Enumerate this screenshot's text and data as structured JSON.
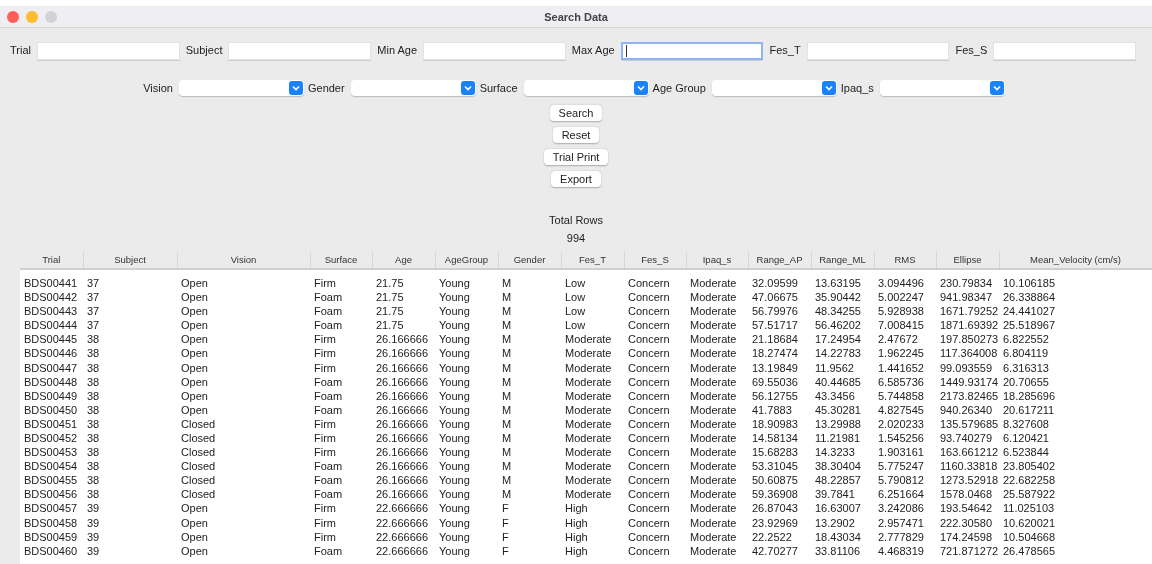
{
  "window": {
    "title": "Search Data"
  },
  "text_fields": [
    {
      "label": "Trial",
      "focused": false
    },
    {
      "label": "Subject",
      "focused": false
    },
    {
      "label": "Min Age",
      "focused": false
    },
    {
      "label": "Max Age",
      "focused": true
    },
    {
      "label": "Fes_T",
      "focused": false
    },
    {
      "label": "Fes_S",
      "focused": false
    }
  ],
  "dropdowns": [
    {
      "label": "Vision"
    },
    {
      "label": "Gender"
    },
    {
      "label": "Surface"
    },
    {
      "label": "Age Group"
    },
    {
      "label": "Ipaq_s"
    }
  ],
  "buttons": [
    "Search",
    "Reset",
    "Trial Print",
    "Export"
  ],
  "total": {
    "label": "Total Rows",
    "value": "994"
  },
  "table": {
    "columns": [
      "Trial",
      "Subject",
      "Vision",
      "Surface",
      "Age",
      "AgeGroup",
      "Gender",
      "Fes_T",
      "Fes_S",
      "Ipaq_s",
      "Range_AP",
      "Range_ML",
      "RMS",
      "Ellipse",
      "Mean_Velocity (cm/s)"
    ],
    "rows": [
      [
        "BDS00441",
        "37",
        "Open",
        "Firm",
        "21.75",
        "Young",
        "M",
        "Low",
        "Concern",
        "Moderate",
        "32.09599",
        "13.63195",
        "3.094496",
        "230.79834",
        "10.106185"
      ],
      [
        "BDS00442",
        "37",
        "Open",
        "Foam",
        "21.75",
        "Young",
        "M",
        "Low",
        "Concern",
        "Moderate",
        "47.06675",
        "35.90442",
        "5.002247",
        "941.98347",
        "26.338864"
      ],
      [
        "BDS00443",
        "37",
        "Open",
        "Foam",
        "21.75",
        "Young",
        "M",
        "Low",
        "Concern",
        "Moderate",
        "56.79976",
        "48.34255",
        "5.928938",
        "1671.79252",
        "24.441027"
      ],
      [
        "BDS00444",
        "37",
        "Open",
        "Foam",
        "21.75",
        "Young",
        "M",
        "Low",
        "Concern",
        "Moderate",
        "57.51717",
        "56.46202",
        "7.008415",
        "1871.69392",
        "25.518967"
      ],
      [
        "BDS00445",
        "38",
        "Open",
        "Firm",
        "26.166666",
        "Young",
        "M",
        "Moderate",
        "Concern",
        "Moderate",
        "21.18684",
        "17.24954",
        "2.47672",
        "197.850273",
        "6.822552"
      ],
      [
        "BDS00446",
        "38",
        "Open",
        "Firm",
        "26.166666",
        "Young",
        "M",
        "Moderate",
        "Concern",
        "Moderate",
        "18.27474",
        "14.22783",
        "1.962245",
        "117.364008",
        "6.804119"
      ],
      [
        "BDS00447",
        "38",
        "Open",
        "Firm",
        "26.166666",
        "Young",
        "M",
        "Moderate",
        "Concern",
        "Moderate",
        "13.19849",
        "11.9562",
        "1.441652",
        "99.093559",
        "6.316313"
      ],
      [
        "BDS00448",
        "38",
        "Open",
        "Foam",
        "26.166666",
        "Young",
        "M",
        "Moderate",
        "Concern",
        "Moderate",
        "69.55036",
        "40.44685",
        "6.585736",
        "1449.93174",
        "20.70655"
      ],
      [
        "BDS00449",
        "38",
        "Open",
        "Foam",
        "26.166666",
        "Young",
        "M",
        "Moderate",
        "Concern",
        "Moderate",
        "56.12755",
        "43.3456",
        "5.744858",
        "2173.82465",
        "18.285696"
      ],
      [
        "BDS00450",
        "38",
        "Open",
        "Foam",
        "26.166666",
        "Young",
        "M",
        "Moderate",
        "Concern",
        "Moderate",
        "41.7883",
        "45.30281",
        "4.827545",
        "940.26340",
        "20.617211"
      ],
      [
        "BDS00451",
        "38",
        "Closed",
        "Firm",
        "26.166666",
        "Young",
        "M",
        "Moderate",
        "Concern",
        "Moderate",
        "18.90983",
        "13.29988",
        "2.020233",
        "135.579685",
        "8.327608"
      ],
      [
        "BDS00452",
        "38",
        "Closed",
        "Firm",
        "26.166666",
        "Young",
        "M",
        "Moderate",
        "Concern",
        "Moderate",
        "14.58134",
        "11.21981",
        "1.545256",
        "93.740279",
        "6.120421"
      ],
      [
        "BDS00453",
        "38",
        "Closed",
        "Firm",
        "26.166666",
        "Young",
        "M",
        "Moderate",
        "Concern",
        "Moderate",
        "15.68283",
        "14.3233",
        "1.903161",
        "163.661212",
        "6.523844"
      ],
      [
        "BDS00454",
        "38",
        "Closed",
        "Foam",
        "26.166666",
        "Young",
        "M",
        "Moderate",
        "Concern",
        "Moderate",
        "53.31045",
        "38.30404",
        "5.775247",
        "1160.33818",
        "23.805402"
      ],
      [
        "BDS00455",
        "38",
        "Closed",
        "Foam",
        "26.166666",
        "Young",
        "M",
        "Moderate",
        "Concern",
        "Moderate",
        "50.60875",
        "48.22857",
        "5.790812",
        "1273.52918",
        "22.682258"
      ],
      [
        "BDS00456",
        "38",
        "Closed",
        "Foam",
        "26.166666",
        "Young",
        "M",
        "Moderate",
        "Concern",
        "Moderate",
        "59.36908",
        "39.7841",
        "6.251664",
        "1578.0468",
        "25.587922"
      ],
      [
        "BDS00457",
        "39",
        "Open",
        "Firm",
        "22.666666",
        "Young",
        "F",
        "High",
        "Concern",
        "Moderate",
        "26.87043",
        "16.63007",
        "3.242086",
        "193.54642",
        "11.025103"
      ],
      [
        "BDS00458",
        "39",
        "Open",
        "Firm",
        "22.666666",
        "Young",
        "F",
        "High",
        "Concern",
        "Moderate",
        "23.92969",
        "13.2902",
        "2.957471",
        "222.30580",
        "10.620021"
      ],
      [
        "BDS00459",
        "39",
        "Open",
        "Firm",
        "22.666666",
        "Young",
        "F",
        "High",
        "Concern",
        "Moderate",
        "22.2522",
        "18.43034",
        "2.777829",
        "174.24598",
        "10.504668"
      ],
      [
        "BDS00460",
        "39",
        "Open",
        "Foam",
        "22.666666",
        "Young",
        "F",
        "High",
        "Concern",
        "Moderate",
        "42.70277",
        "33.81106",
        "4.468319",
        "721.871272",
        "26.478565"
      ]
    ]
  }
}
